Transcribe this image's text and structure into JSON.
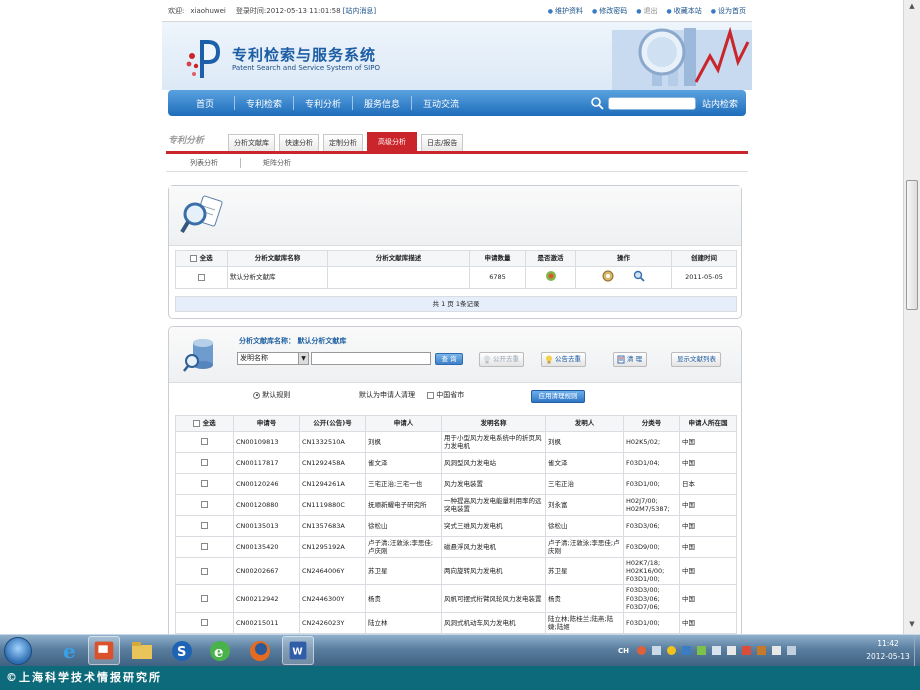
{
  "topbar": {
    "welcome_label": "欢迎:",
    "username": "xiaohuwei",
    "login_time_label": "登录时间:",
    "login_time": "2012-05-13 11:01:58",
    "messages_link": "[站内消息]",
    "links": [
      "维护资料",
      "修改密码",
      "退出",
      "收藏本站",
      "设为首页"
    ]
  },
  "header": {
    "title": "专利检索与服务系统",
    "subtitle": "Patent Search and Service System of SIPO"
  },
  "nav": {
    "items": [
      "首页",
      "专利检索",
      "专利分析",
      "服务信息",
      "互动交流"
    ],
    "search_button": "站内检索"
  },
  "tabs": {
    "section_title": "专利分析",
    "items": [
      "分析文献库",
      "快速分析",
      "定制分析",
      "高级分析",
      "日志/报告"
    ],
    "active_index": 3
  },
  "subtabs": [
    "列表分析",
    "矩阵分析"
  ],
  "library_table": {
    "headers": [
      "全选",
      "分析文献库名称",
      "分析文献库描述",
      "申请数量",
      "是否激活",
      "操作",
      "创建时间"
    ],
    "rows": [
      {
        "name": "默认分析文献库",
        "desc": "",
        "count": "6785",
        "created": "2011-05-05"
      }
    ],
    "pager": "共 1 页 1条记录"
  },
  "search_panel": {
    "lib_label": "分析文献库名称：",
    "lib_name": "默认分析文献库",
    "field_value": "发明名称",
    "query_button": "查 询",
    "buttons": {
      "public_dedupe": "公开去重",
      "announce_dedupe": "公告去重",
      "clear": "清 理",
      "show_list": "显示文献列表"
    },
    "rule_default": "默认规则",
    "rule_applicant": "默认为申请人清理",
    "rule_china": "中国省市",
    "apply_button": "应用清理规则"
  },
  "patent_table": {
    "headers": [
      "全选",
      "申请号",
      "公开(公告)号",
      "申请人",
      "发明名称",
      "发明人",
      "分类号",
      "申请人所在国"
    ],
    "rows": [
      [
        "CN00109813",
        "CN1332510A",
        "刘枫",
        "用于小型风力发电系统中的折页风力发电机",
        "刘枫",
        "H02K5/02;",
        "中国"
      ],
      [
        "CN00117817",
        "CN1292458A",
        "雀文泽",
        "风洞型风力发电站",
        "雀文泽",
        "F03D1/04;",
        "中国"
      ],
      [
        "CN00120246",
        "CN1294261A",
        "三宅正治;三宅一也",
        "风力发电装置",
        "三宅正治",
        "F03D1/00;",
        "日本"
      ],
      [
        "CN00120880",
        "CN1119880C",
        "抚顺新耀电子研究所",
        "一种提高风力发电能量利用率的远突电装置",
        "刘永富",
        "H02J7/00; H02M7/5387;",
        "中国"
      ],
      [
        "CN00135013",
        "CN1357683A",
        "徐松山",
        "突式三维风力发电机",
        "徐松山",
        "F03D3/06;",
        "中国"
      ],
      [
        "CN00135420",
        "CN1295192A",
        "卢子清;汪敦泳;李思佳;卢庆刚",
        "磁悬浮风力发电机",
        "卢子清;汪敦泳;李思佳;卢庆刚",
        "F03D9/00;",
        "中国"
      ],
      [
        "CN00202667",
        "CN2464006Y",
        "苏卫星",
        "两向旋转风力发电机",
        "苏卫星",
        "H02K7/18; H02K16/00; F03D1/00;",
        "中国"
      ],
      [
        "CN00212942",
        "CN2446300Y",
        "杨贵",
        "风帆可摆式桁臂风轮风力发电装置",
        "杨贵",
        "F03D3/00; F03D3/06; F03D7/06;",
        "中国"
      ],
      [
        "CN00215011",
        "CN2426023Y",
        "陆立林",
        "风洞式机动车风力发电机",
        "陆立林;陈桂兰;陆燕;陆婕;陆姬",
        "F03D1/00;",
        "中国"
      ]
    ]
  },
  "taskbar": {
    "language": "CH",
    "clock_time": "11:42",
    "clock_date": "2012-05-13"
  },
  "footer_text": "©上海科学技术情报研究所"
}
